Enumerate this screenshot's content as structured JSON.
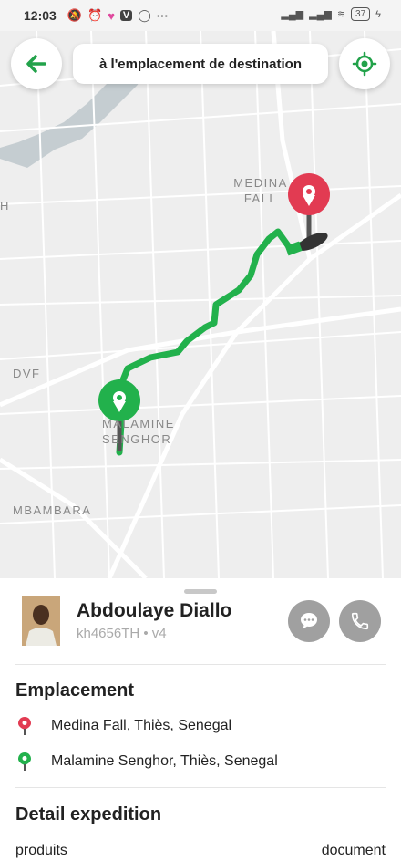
{
  "status_bar": {
    "time": "12:03",
    "battery": "37"
  },
  "header": {
    "back_icon": "arrow-left-icon",
    "destination_label": "à l'emplacement de destination",
    "locate_icon": "crosshair-icon"
  },
  "map": {
    "labels": [
      "MEDINA FALL",
      "DVF",
      "MALAMINE SENGHOR",
      "MBAMBARA",
      "H"
    ],
    "route_color": "#22b14c",
    "destination_pin_color": "#e23b52",
    "origin_pin_color": "#22b14c"
  },
  "driver": {
    "name": "Abdoulaye Diallo",
    "subtitle": "kh4656TH • v4",
    "chat_icon": "chat-icon",
    "phone_icon": "phone-icon"
  },
  "location_section": {
    "title": "Emplacement",
    "destination": "Medina Fall, Thiès, Senegal",
    "origin": "Malamine Senghor, Thiès, Senegal"
  },
  "detail_section": {
    "title": "Detail expedition",
    "products_label": "produits",
    "products_value": "document"
  }
}
